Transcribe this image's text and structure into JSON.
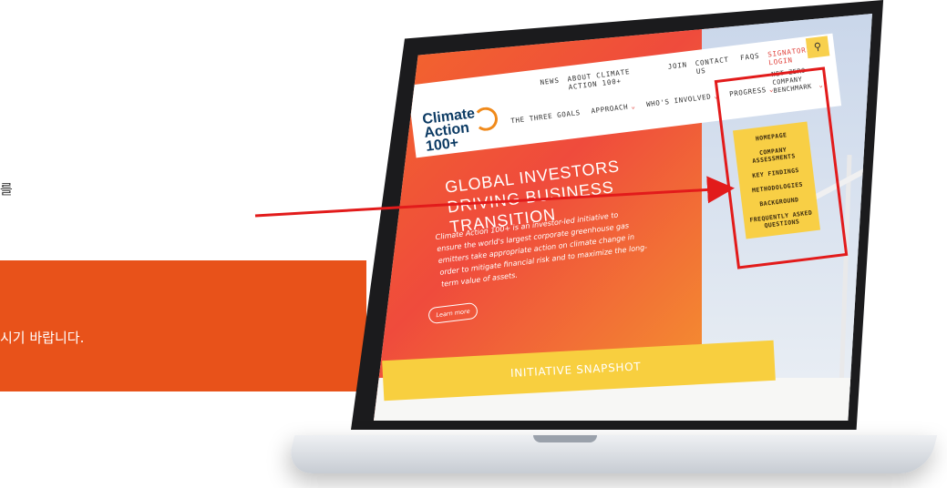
{
  "side": {
    "korean_top": "를",
    "korean_bottom": "시기 바랍니다."
  },
  "site": {
    "logo_line1": "Climate",
    "logo_line2": "Action 100+",
    "top_links": [
      "NEWS",
      "ABOUT CLIMATE ACTION 100+",
      "JOIN",
      "CONTACT US",
      "FAQS"
    ],
    "signatories_login": "SIGNATORIES' LOGIN",
    "search_icon": "search-icon",
    "main_menu": [
      "THE THREE GOALS",
      "APPROACH",
      "WHO'S INVOLVED",
      "PROGRESS"
    ],
    "net_zero": "NET ZERO COMPANY BENCHMARK",
    "dropdown": [
      "HOMEPAGE",
      "COMPANY ASSESSMENTS",
      "KEY FINDINGS",
      "METHODOLOGIES",
      "BACKGROUND",
      "FREQUENTLY ASKED QUESTIONS"
    ],
    "hero_title": "GLOBAL INVESTORS DRIVING BUSINESS TRANSITION",
    "hero_text": "Climate Action 100+ is an investor-led initiative to ensure the world's largest corporate greenhouse gas emitters take appropriate action on climate change in order to mitigate financial risk and to maximize the long-term value of assets.",
    "learn_more": "Learn more",
    "snapshot": "INITIATIVE SNAPSHOT"
  },
  "colors": {
    "accent_orange": "#e8521a",
    "highlight_red": "#e21b1b",
    "menu_yellow": "#f8cf45"
  }
}
